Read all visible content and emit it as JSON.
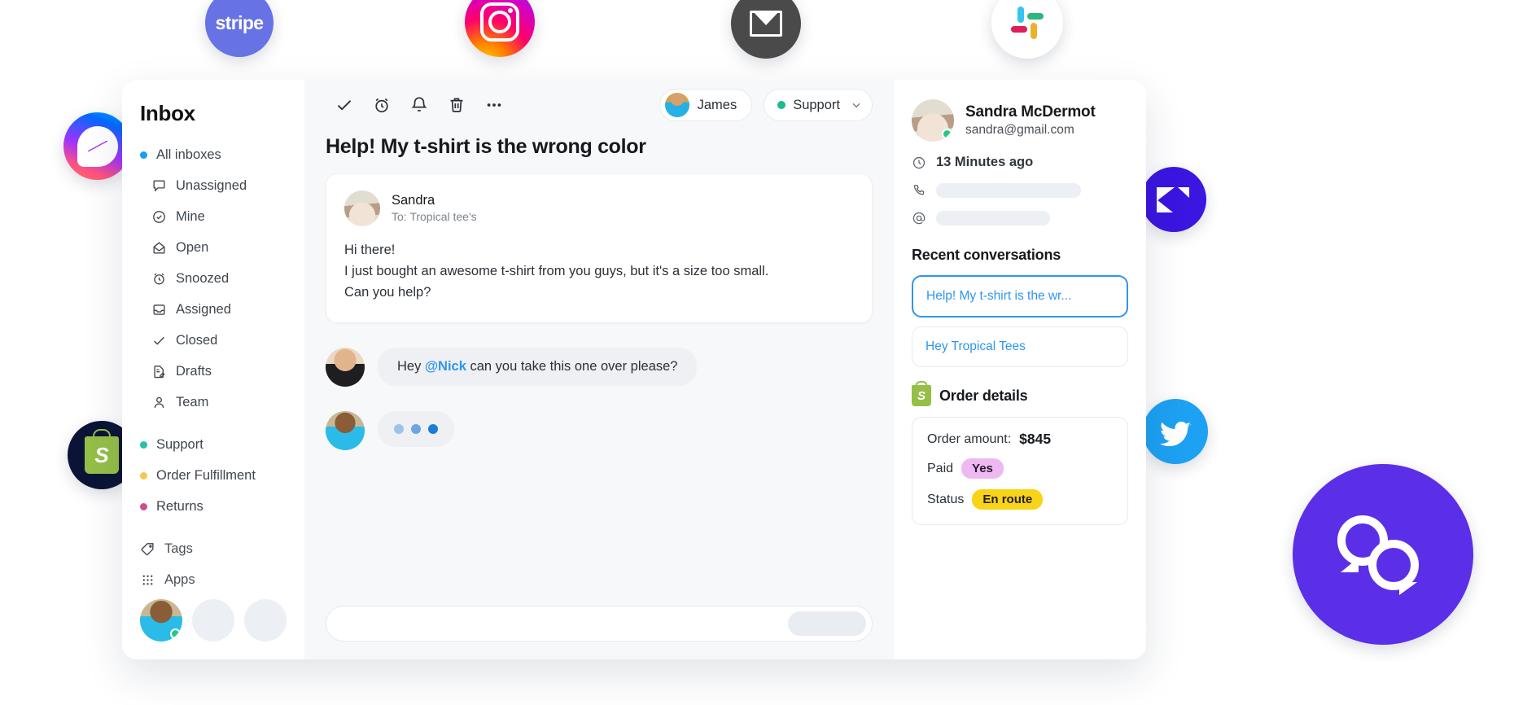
{
  "integrations": [
    {
      "name": "stripe",
      "label": "stripe"
    },
    {
      "name": "instagram",
      "label": ""
    },
    {
      "name": "email",
      "label": ""
    },
    {
      "name": "slack",
      "label": ""
    },
    {
      "name": "messenger",
      "label": ""
    },
    {
      "name": "shopify",
      "label": "S"
    },
    {
      "name": "intercom",
      "label": ""
    },
    {
      "name": "twitter",
      "label": ""
    },
    {
      "name": "chat-bubble",
      "label": ""
    }
  ],
  "sidebar": {
    "title": "Inbox",
    "all_inboxes": {
      "label": "All inboxes",
      "dot_color": "#1a9cf0"
    },
    "items": [
      {
        "label": "Unassigned",
        "icon": "comment-icon"
      },
      {
        "label": "Mine",
        "icon": "check-circle-icon"
      },
      {
        "label": "Open",
        "icon": "open-envelope-icon"
      },
      {
        "label": "Snoozed",
        "icon": "alarm-clock-icon"
      },
      {
        "label": "Assigned",
        "icon": "inbox-tray-icon"
      },
      {
        "label": "Closed",
        "icon": "check-icon"
      },
      {
        "label": "Drafts",
        "icon": "draft-document-icon"
      },
      {
        "label": "Team",
        "icon": "person-icon"
      }
    ],
    "teams": [
      {
        "label": "Support",
        "dot_color": "#27c2a0"
      },
      {
        "label": "Order Fulfillment",
        "dot_color": "#f5c84c"
      },
      {
        "label": "Returns",
        "dot_color": "#cc4f91"
      }
    ],
    "footer_items": [
      {
        "label": "Tags",
        "icon": "tag-icon"
      },
      {
        "label": "Apps",
        "icon": "grid-apps-icon"
      }
    ]
  },
  "toolbar": {
    "icons": [
      {
        "name": "check-icon",
        "label": "Close conversation"
      },
      {
        "name": "alarm-clock-icon",
        "label": "Snooze"
      },
      {
        "name": "bell-icon",
        "label": "Notifications"
      },
      {
        "name": "trash-icon",
        "label": "Delete"
      },
      {
        "name": "more-horizontal-icon",
        "label": "More"
      }
    ],
    "assignee_chip": {
      "label": "James"
    },
    "status_chip": {
      "label": "Support",
      "dot_color": "#17bd8d"
    }
  },
  "conversation": {
    "title": "Help! My t-shirt is the wrong color",
    "first_message": {
      "author": "Sandra",
      "recipient": "To: Tropical tee's",
      "lines": [
        "Hi there!",
        "I just bought an awesome t-shirt from you guys, but it's a size too small.",
        "Can you help?"
      ]
    },
    "reply": {
      "text_before": "Hey ",
      "mention": "@Nick",
      "text_after": " can you take this one over please?"
    },
    "typing_indicator": {
      "dots": 3
    },
    "composer": {
      "placeholder": ""
    }
  },
  "contact": {
    "name": "Sandra McDermot",
    "email": "sandra@gmail.com",
    "last_seen": "13 Minutes ago",
    "phone_masked": "",
    "handle_masked": ""
  },
  "recent_conversations": {
    "title": "Recent conversations",
    "items": [
      {
        "label": "Help! My t-shirt is the wr...",
        "active": true
      },
      {
        "label": "Hey Tropical Tees",
        "active": false
      }
    ]
  },
  "order_details": {
    "title": "Order details",
    "amount_label": "Order amount:",
    "amount_value": "$845",
    "paid_label": "Paid",
    "paid_value": "Yes",
    "status_label": "Status",
    "status_value": "En route"
  },
  "colors": {
    "accent_blue": "#2f96ee",
    "brand_purple": "#5b2fe8",
    "green": "#17bd8d",
    "paid_pill": "#eeb9f3",
    "status_pill": "#f7d417"
  }
}
